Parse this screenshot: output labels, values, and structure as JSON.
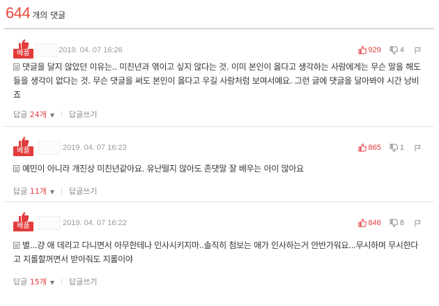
{
  "header": {
    "count": "644",
    "suffix": "개의 댓글"
  },
  "colors": {
    "accent": "#e23b3b",
    "muted": "#999999",
    "text": "#333333"
  },
  "comments": [
    {
      "badge": "베플",
      "date": "2019. 04. 07 16:26",
      "up": "929",
      "down": "4",
      "text": "댓글을 달지 않았던 이유는.. 미친년과 엮이고 싶지 않다는 것. 이미 본인이 옳다고 생각하는 사람에게는 무슨 말을 해도 들을 생각이 없다는 것. 무슨 댓글을 써도 본인이 옳다고 우길 사람처럼 보여서예요. 그런 글에 댓글을 달아봐야 시간 낭비죠",
      "reply_label": "답글",
      "reply_count": "24개",
      "write_reply": "답글쓰기"
    },
    {
      "badge": "베플",
      "date": "2019. 04. 07 16:23",
      "up": "865",
      "down": "1",
      "text": "예민이 아니라 개진상 미친년같아요. 유난떨지 않아도 존댓말 잘 배우는 아이 많아요",
      "reply_label": "답글",
      "reply_count": "11개",
      "write_reply": "답글쓰기"
    },
    {
      "badge": "베플",
      "date": "2019. 04. 07 16:22",
      "up": "846",
      "down": "8",
      "text": "별...걍 애 데리고 다니면서 아무한테나 인사시키지마..솔직히 첨보는 애가 인사하는거 안반가워요...무시하며 무시한다고 지롤할꺼면서 받아줘도 지롤이야",
      "reply_label": "답글",
      "reply_count": "15개",
      "write_reply": "답글쓰기"
    }
  ]
}
